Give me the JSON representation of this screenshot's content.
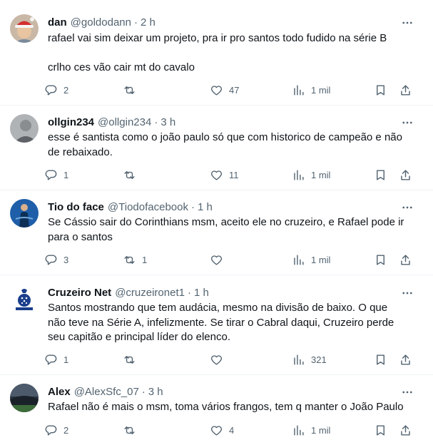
{
  "tweets": [
    {
      "name": "dan",
      "handle": "@goldodann",
      "time": "2 h",
      "text_lines": [
        "rafael vai sim deixar um projeto, pra ir pro santos todo fudido na série B",
        "crlho ces vão cair mt do cavalo"
      ],
      "replies": "2",
      "retweets": "",
      "likes": "47",
      "views": "1 mil",
      "avatar": "santa-hat-avatar"
    },
    {
      "name": "ollgin234",
      "handle": "@ollgin234",
      "time": "3 h",
      "text_lines": [
        "esse é santista como o joão paulo só que com historico de campeão e não",
        "de rebaixado."
      ],
      "replies": "1",
      "retweets": "",
      "likes": "11",
      "views": "1 mil",
      "avatar": "grey-portrait-avatar"
    },
    {
      "name": "Tio do face",
      "handle": "@Tiodofacebook",
      "time": "1 h",
      "text_lines": [
        "Se Cássio sair do Corinthians msm, aceito ele no cruzeiro, e Rafael pode ir",
        "para o santos"
      ],
      "replies": "3",
      "retweets": "1",
      "likes": "",
      "views": "1 mil",
      "avatar": "blue-figure-avatar"
    },
    {
      "name": "Cruzeiro Net",
      "handle": "@cruzeironet1",
      "time": "1 h",
      "text_lines": [
        "Santos mostrando que tem audácia, mesmo na divisão de baixo. O que",
        "não teve na Série A, infelizmente. Se tirar o Cabral daqui, Cruzeiro perde",
        "seu capitão e principal líder do elenco."
      ],
      "replies": "1",
      "retweets": "",
      "likes": "",
      "views": "321",
      "avatar": "cruzeiro-logo-avatar"
    },
    {
      "name": "Alex",
      "handle": "@AlexSfc_07",
      "time": "3 h",
      "text_lines": [
        "Rafael não é mais o msm, toma vários frangos, tem q manter o João Paulo"
      ],
      "replies": "2",
      "retweets": "",
      "likes": "4",
      "views": "1 mil",
      "avatar": "stadium-avatar"
    }
  ],
  "separator": "·",
  "colors": {
    "text": "#0f1419",
    "secondary": "#536471",
    "divider": "#eff3f4"
  }
}
